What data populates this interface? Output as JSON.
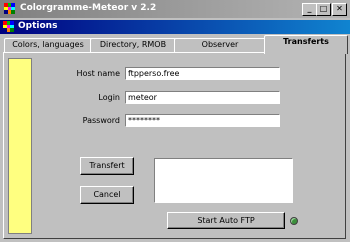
{
  "main_window": {
    "title": "Colorgramme-Meteor v 2.2",
    "minimize_glyph": "_",
    "maximize_glyph": "□",
    "close_glyph": "✕"
  },
  "dialog": {
    "title": "Options"
  },
  "tabs": [
    {
      "label": "Colors, languages",
      "active": false
    },
    {
      "label": "Directory, RMOB",
      "active": false
    },
    {
      "label": "Observer",
      "active": false
    },
    {
      "label": "Transferts",
      "active": true
    }
  ],
  "form": {
    "host": {
      "label": "Host name",
      "value": "ftpperso.free"
    },
    "login": {
      "label": "Login",
      "value": "meteor"
    },
    "password": {
      "label": "Password",
      "value": "********"
    }
  },
  "buttons": {
    "transfert": "Transfert",
    "cancel": "Cancel",
    "start_auto_ftp": "Start Auto FTP"
  },
  "colors": {
    "sidebar": "#ffff80",
    "status_led": "#3b8f3b"
  }
}
